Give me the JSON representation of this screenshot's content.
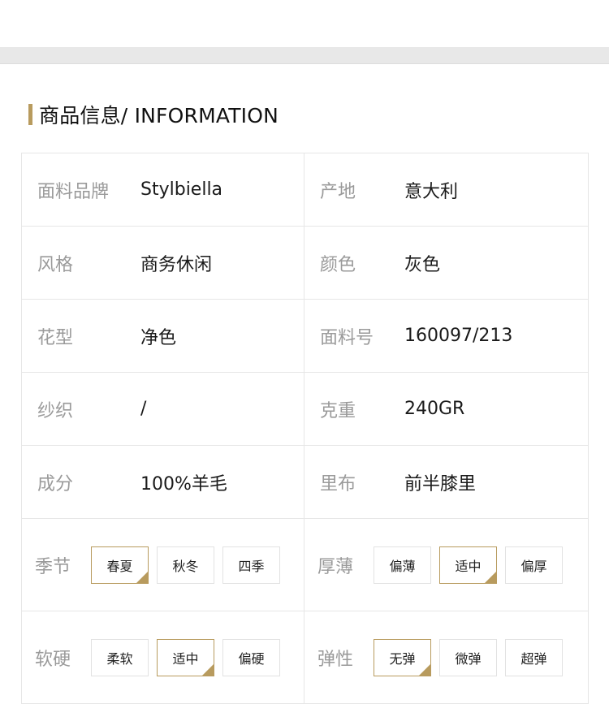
{
  "section": {
    "title": "商品信息/ INFORMATION"
  },
  "rows": [
    {
      "left": {
        "label": "面料品牌",
        "value": "Stylbiella"
      },
      "right": {
        "label": "产地",
        "value": "意大利"
      }
    },
    {
      "left": {
        "label": "风格",
        "value": "商务休闲"
      },
      "right": {
        "label": "颜色",
        "value": "灰色"
      }
    },
    {
      "left": {
        "label": "花型",
        "value": "净色"
      },
      "right": {
        "label": "面料号",
        "value": "160097/213"
      }
    },
    {
      "left": {
        "label": "纱织",
        "value": "/"
      },
      "right": {
        "label": "克重",
        "value": "240GR"
      }
    },
    {
      "left": {
        "label": "成分",
        "value": "100%羊毛"
      },
      "right": {
        "label": "里布",
        "value": "前半膝里"
      }
    }
  ],
  "option_rows": [
    {
      "left": {
        "label": "季节",
        "options": [
          "春夏",
          "秋冬",
          "四季"
        ],
        "selected": 0
      },
      "right": {
        "label": "厚薄",
        "options": [
          "偏薄",
          "适中",
          "偏厚"
        ],
        "selected": 1
      }
    },
    {
      "left": {
        "label": "软硬",
        "options": [
          "柔软",
          "适中",
          "偏硬"
        ],
        "selected": 1
      },
      "right": {
        "label": "弹性",
        "options": [
          "无弹",
          "微弹",
          "超弹"
        ],
        "selected": 0
      }
    }
  ],
  "colors": {
    "accent": "#b89b5e",
    "label_gray": "#9a9a9a",
    "border": "#e6e6e6"
  }
}
